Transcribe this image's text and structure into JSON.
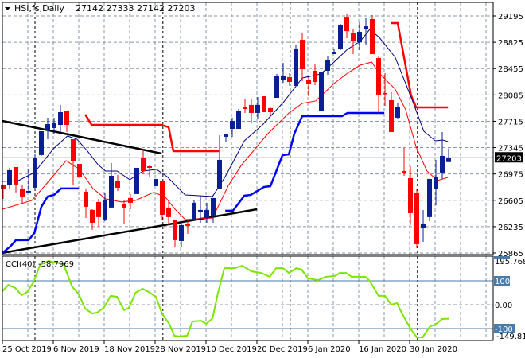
{
  "chart_data": [
    {
      "type": "candlestick",
      "title": "HSI,fs,Daily",
      "ohlc_readout": "27142 27333 27142 27203",
      "current_price_label": "27203",
      "current_price": 27203,
      "ylim": [
        25865,
        29195
      ],
      "y_ticks": [
        "29195",
        "28825",
        "28455",
        "28085",
        "27715",
        "27345",
        "26975",
        "26605",
        "26235",
        "25865"
      ],
      "y_tick_values": [
        29195,
        28825,
        28455,
        28085,
        27715,
        27345,
        26975,
        26605,
        26235,
        25865
      ],
      "x_tick_labels": [
        "25 Oct 2019",
        "6 Nov 2019",
        "18 Nov 2019",
        "28 Nov 2019",
        "10 Dec 2019",
        "20 Dec 2019",
        "6 Jan 2020",
        "16 Jan 2020",
        "30 Jan 2020"
      ],
      "x_tick_bar_index": [
        1,
        9,
        17,
        25,
        33,
        41,
        49,
        57,
        65
      ],
      "month_separator_bar_index": [
        6,
        26.1,
        46.1,
        66.1
      ],
      "colors": {
        "bull": "#0a1e96",
        "bear": "#ff0000",
        "ma_fast": "#000080",
        "ma_slow": "#ff0000",
        "support": "#0000ff",
        "resistance": "#ff0000",
        "trend": "#000000",
        "cci": "#7ce600",
        "level": "#4a7ba7"
      },
      "candles_ohlc": [
        [
          26815,
          26827,
          26625,
          26771
        ],
        [
          26815,
          27061,
          26760,
          27028
        ],
        [
          27072,
          27072,
          26715,
          26827
        ],
        [
          26760,
          26815,
          26558,
          26659
        ],
        [
          26715,
          27039,
          26715,
          26737
        ],
        [
          26782,
          27251,
          26760,
          27195
        ],
        [
          27240,
          27575,
          27229,
          27575
        ],
        [
          27597,
          27765,
          27463,
          27675
        ],
        [
          27620,
          27765,
          27541,
          27698
        ],
        [
          27664,
          27944,
          27553,
          27843
        ],
        [
          27854,
          27854,
          27564,
          27664
        ],
        [
          27463,
          27463,
          26815,
          27150
        ],
        [
          27117,
          27117,
          26927,
          26927
        ],
        [
          26726,
          26760,
          26357,
          26514
        ],
        [
          26469,
          26480,
          26190,
          26290
        ],
        [
          26581,
          26625,
          26235,
          26369
        ],
        [
          26335,
          26704,
          26313,
          26603
        ],
        [
          26503,
          27128,
          26503,
          26949
        ],
        [
          26871,
          26961,
          26737,
          26782
        ],
        [
          26558,
          26603,
          26268,
          26503
        ],
        [
          26637,
          26693,
          26480,
          26570
        ],
        [
          26693,
          27061,
          26693,
          27061
        ],
        [
          27206,
          27329,
          26972,
          27016
        ],
        [
          27083,
          27106,
          26927,
          27061
        ],
        [
          26804,
          26905,
          26804,
          26905
        ],
        [
          26871,
          26871,
          26324,
          26402
        ],
        [
          26503,
          26603,
          26257,
          26369
        ],
        [
          26335,
          26335,
          25955,
          26045
        ],
        [
          26033,
          26302,
          25955,
          26257
        ],
        [
          26279,
          26324,
          26134,
          26246
        ],
        [
          26324,
          26603,
          26324,
          26570
        ],
        [
          26436,
          26670,
          26290,
          26469
        ],
        [
          26357,
          26570,
          26290,
          26469
        ],
        [
          26391,
          26637,
          26290,
          26637
        ],
        [
          26771,
          27519,
          26771,
          27173
        ],
        [
          27497,
          27530,
          27419,
          27530
        ],
        [
          27608,
          27765,
          27497,
          27720
        ],
        [
          27608,
          27888,
          27608,
          27854
        ],
        [
          27910,
          28022,
          27832,
          27888
        ],
        [
          27944,
          28033,
          27698,
          27832
        ],
        [
          27832,
          28055,
          27742,
          27944
        ],
        [
          28066,
          28066,
          27843,
          27843
        ],
        [
          27899,
          27921,
          27798,
          27843
        ],
        [
          28044,
          28379,
          28044,
          28346
        ],
        [
          28301,
          28536,
          28256,
          28357
        ],
        [
          28335,
          28390,
          28212,
          28267
        ],
        [
          28212,
          28781,
          28212,
          28737
        ],
        [
          28859,
          28949,
          28279,
          28446
        ],
        [
          28301,
          28335,
          28066,
          28245
        ],
        [
          28424,
          28524,
          28223,
          28267
        ],
        [
          27865,
          28413,
          27865,
          28413
        ],
        [
          28424,
          28625,
          28368,
          28569
        ],
        [
          28658,
          28737,
          28658,
          28692
        ],
        [
          28725,
          29083,
          28714,
          29061
        ],
        [
          29183,
          29217,
          28882,
          28982
        ],
        [
          28949,
          29005,
          28658,
          28837
        ],
        [
          28826,
          29105,
          28714,
          28971
        ],
        [
          29016,
          29161,
          28792,
          29049
        ],
        [
          29150,
          29206,
          28658,
          28658
        ],
        [
          28603,
          28625,
          27832,
          28078
        ],
        [
          28111,
          28390,
          27932,
          28100
        ],
        [
          28011,
          28122,
          27564,
          27564
        ],
        [
          27765,
          27966,
          27754,
          27910
        ],
        [
          27016,
          27340,
          26949,
          26994
        ],
        [
          26916,
          27083,
          26257,
          26424
        ],
        [
          26704,
          26760,
          25933,
          25989
        ],
        [
          26212,
          26469,
          26022,
          26279
        ],
        [
          26369,
          26905,
          26313,
          26905
        ],
        [
          26760,
          27173,
          26536,
          26938
        ],
        [
          26994,
          27564,
          26905,
          27229
        ],
        [
          27142,
          27333,
          27142,
          27203
        ]
      ],
      "ma_fast": [
        [
          0.9,
          26871
        ],
        [
          3.4,
          26882
        ],
        [
          5.9,
          26994
        ],
        [
          8.9,
          27329
        ],
        [
          11.1,
          27508
        ],
        [
          12.6,
          27463
        ],
        [
          14.25,
          27296
        ],
        [
          15.9,
          27106
        ],
        [
          17.1,
          27016
        ],
        [
          18.9,
          27016
        ],
        [
          20.9,
          26894
        ],
        [
          23,
          27016
        ],
        [
          25.1,
          27039
        ],
        [
          26.75,
          26938
        ],
        [
          29.6,
          26681
        ],
        [
          33.9,
          26659
        ],
        [
          35.9,
          26938
        ],
        [
          38.9,
          27441
        ],
        [
          41.75,
          27664
        ],
        [
          45.1,
          27988
        ],
        [
          48,
          28323
        ],
        [
          50.9,
          28379
        ],
        [
          53,
          28547
        ],
        [
          55.1,
          28725
        ],
        [
          57.1,
          28837
        ],
        [
          58.6,
          29005
        ],
        [
          60.1,
          28893
        ],
        [
          62.6,
          28614
        ],
        [
          65.1,
          28055
        ],
        [
          67.1,
          27575
        ],
        [
          68.9,
          27441
        ],
        [
          70.1,
          27452
        ],
        [
          70.9,
          27430
        ]
      ],
      "ma_slow": [
        [
          0.9,
          26480
        ],
        [
          5.5,
          26603
        ],
        [
          7.6,
          26815
        ],
        [
          10.9,
          27162
        ],
        [
          13,
          27039
        ],
        [
          15.1,
          26771
        ],
        [
          17.1,
          26625
        ],
        [
          19.6,
          26581
        ],
        [
          21.75,
          26603
        ],
        [
          24.6,
          26715
        ],
        [
          26.4,
          26659
        ],
        [
          28,
          26480
        ],
        [
          29.6,
          26335
        ],
        [
          31.75,
          26346
        ],
        [
          33.9,
          26357
        ],
        [
          36.4,
          26815
        ],
        [
          38.4,
          27095
        ],
        [
          42.6,
          27541
        ],
        [
          45.9,
          27832
        ],
        [
          48,
          27966
        ],
        [
          50.1,
          28000
        ],
        [
          53,
          28245
        ],
        [
          55.1,
          28390
        ],
        [
          57.1,
          28502
        ],
        [
          58.9,
          28547
        ],
        [
          60.1,
          28390
        ],
        [
          62.6,
          28167
        ],
        [
          64.25,
          27877
        ],
        [
          65.9,
          27352
        ],
        [
          67.6,
          27016
        ],
        [
          69.25,
          26882
        ],
        [
          70.9,
          26927
        ]
      ],
      "support_segments": [
        [
          [
            0.875,
            25866
          ],
          [
            2.1,
            25955
          ],
          [
            3,
            26045
          ],
          [
            5,
            26045
          ],
          [
            5.9,
            26145
          ],
          [
            7,
            26514
          ],
          [
            8,
            26659
          ],
          [
            9,
            26681
          ],
          [
            10.1,
            26771
          ],
          [
            12.9,
            26771
          ]
        ],
        [
          [
            35.9,
            26458
          ],
          [
            37.1,
            26458
          ],
          [
            38.9,
            26670
          ],
          [
            39.9,
            26681
          ],
          [
            42,
            26793
          ],
          [
            43,
            26804
          ],
          [
            44.9,
            27240
          ],
          [
            45.9,
            27251
          ],
          [
            46.75,
            27541
          ],
          [
            48,
            27787
          ],
          [
            54.25,
            27787
          ],
          [
            55.1,
            27832
          ],
          [
            60.9,
            27832
          ]
        ]
      ],
      "resistance_segments": [
        [
          [
            13.9,
            27810
          ],
          [
            14.9,
            27664
          ],
          [
            25.9,
            27664
          ],
          [
            27,
            27631
          ],
          [
            27.75,
            27296
          ],
          [
            34.9,
            27296
          ]
        ],
        [
          [
            62,
            29094
          ],
          [
            63,
            29094
          ],
          [
            65.1,
            28078
          ],
          [
            65.9,
            27910
          ],
          [
            70.9,
            27910
          ]
        ]
      ],
      "trendlines": [
        [
          [
            0.875,
            27720
          ],
          [
            25.9,
            27262
          ]
        ],
        [
          [
            0.875,
            25866
          ],
          [
            40.9,
            26480
          ]
        ]
      ]
    },
    {
      "type": "line",
      "title": "CCI(40)",
      "value_label": "-58.7969",
      "ylim": [
        -149.813,
        195.7682
      ],
      "max_label": "195.7682",
      "min_label": "-149.813",
      "levels": [
        100,
        0,
        -100
      ],
      "level_labels": [
        "100",
        "0.00",
        "-100"
      ],
      "points": [
        [
          0.9,
          57
        ],
        [
          1.8,
          83
        ],
        [
          2.9,
          70
        ],
        [
          3.9,
          40
        ],
        [
          4.75,
          53
        ],
        [
          5.75,
          93
        ],
        [
          6.8,
          167
        ],
        [
          8.1,
          183
        ],
        [
          10.5,
          170
        ],
        [
          11.8,
          77
        ],
        [
          12.9,
          43
        ],
        [
          13.9,
          -17
        ],
        [
          15,
          -37
        ],
        [
          15.75,
          -33
        ],
        [
          16.8,
          -13
        ],
        [
          17.9,
          37
        ],
        [
          18.9,
          33
        ],
        [
          20,
          -23
        ],
        [
          20.75,
          -13
        ],
        [
          21.8,
          50
        ],
        [
          22.9,
          67
        ],
        [
          23.9,
          53
        ],
        [
          25,
          33
        ],
        [
          26,
          -40
        ],
        [
          27.1,
          -80
        ],
        [
          27.9,
          -130
        ],
        [
          28.6,
          -133
        ],
        [
          29.9,
          -130
        ],
        [
          30.75,
          -70
        ],
        [
          32.1,
          -67
        ],
        [
          32.9,
          -80
        ],
        [
          33.9,
          -57
        ],
        [
          34.7,
          43
        ],
        [
          35.75,
          153
        ],
        [
          37.3,
          153
        ],
        [
          38.6,
          163
        ],
        [
          40,
          140
        ],
        [
          41.5,
          133
        ],
        [
          42.9,
          117
        ],
        [
          43.9,
          153
        ],
        [
          45,
          153
        ],
        [
          45.9,
          133
        ],
        [
          47.1,
          153
        ],
        [
          47.9,
          147
        ],
        [
          48.9,
          110
        ],
        [
          50.5,
          103
        ],
        [
          51.75,
          117
        ],
        [
          53.1,
          120
        ],
        [
          53.9,
          133
        ],
        [
          54.9,
          133
        ],
        [
          55.75,
          117
        ],
        [
          57.9,
          117
        ],
        [
          58.6,
          100
        ],
        [
          60,
          37
        ],
        [
          61,
          37
        ],
        [
          62,
          0
        ],
        [
          62.9,
          7
        ],
        [
          63.6,
          -33
        ],
        [
          65,
          -100
        ],
        [
          66,
          -137
        ],
        [
          66.9,
          -137
        ],
        [
          68.1,
          -90
        ],
        [
          68.9,
          -83
        ],
        [
          70,
          -60
        ],
        [
          71,
          -58.8
        ]
      ]
    }
  ]
}
